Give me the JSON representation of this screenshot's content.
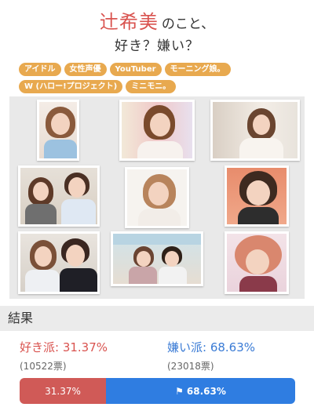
{
  "title": {
    "name": "辻希美",
    "suffix": "のこと、",
    "question": "好き？嫌い？"
  },
  "tags": {
    "row1": [
      "アイドル",
      "女性声優",
      "YouTuber",
      "モーニング娘。"
    ],
    "row2": [
      "W (ハロー!プロジェクト)",
      "ミニモニ。"
    ]
  },
  "results": {
    "header": "結果",
    "like_label": "好き派",
    "like_percent": "31.37%",
    "like_display": "好き派: 31.37%",
    "like_votes": "(10522票)",
    "dislike_label": "嫌い派",
    "dislike_percent": "68.63%",
    "dislike_display": "嫌い派: 68.63%",
    "dislike_votes": "(23018票)",
    "bar_like_text": "31.37%",
    "bar_dislike_text": "68.63%",
    "like_fraction": 0.3137,
    "dislike_fraction": 0.6863
  },
  "colors": {
    "like": "#d9534f",
    "dislike": "#3a7bd5",
    "tag": "#e8a94f"
  },
  "icons": {
    "bar_flag": "checkered-flag-icon"
  }
}
